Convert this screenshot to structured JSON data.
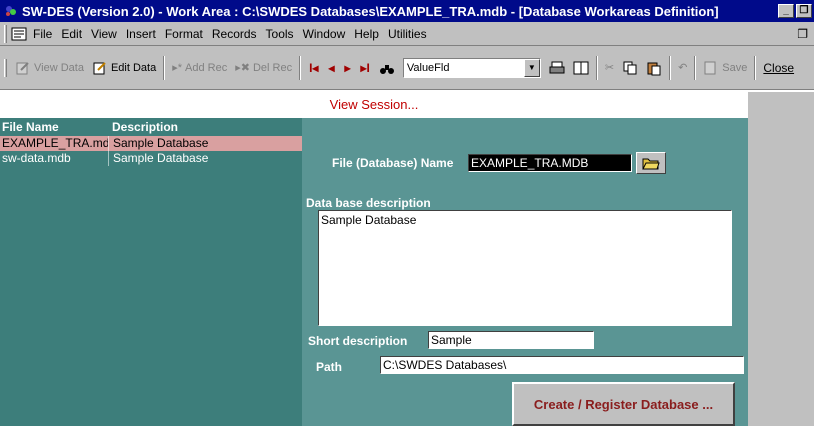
{
  "window": {
    "title": "SW-DES (Version 2.0) - Work Area : C:\\SWDES Databases\\EXAMPLE_TRA.mdb - [Database Workareas Definition]",
    "minimize": "_",
    "restore": "❐"
  },
  "menu": {
    "items": [
      "File",
      "Edit",
      "View",
      "Insert",
      "Format",
      "Records",
      "Tools",
      "Window",
      "Help",
      "Utilities"
    ],
    "doc_restore": "❐"
  },
  "toolbar": {
    "view_data": "View Data",
    "edit_data": "Edit Data",
    "add_rec": "Add Rec",
    "del_rec": "Del Rec",
    "first": "I◂",
    "prev": "◂",
    "next": "▸",
    "last": "▸I",
    "combo_value": "ValueFld",
    "combo_arrow": "▼",
    "save": "Save",
    "close": "Close"
  },
  "session": {
    "label": "View Session..."
  },
  "list": {
    "header_name": "File Name",
    "header_desc": "Description",
    "rows": [
      {
        "name": "EXAMPLE_TRA.mdb",
        "desc": "Sample Database"
      },
      {
        "name": "sw-data.mdb",
        "desc": "Sample Database"
      }
    ]
  },
  "detail": {
    "file_label": "File (Database)  Name",
    "file_value": "EXAMPLE_TRA.MDB",
    "desc_label": "Data base description",
    "desc_value": "Sample Database",
    "short_label": "Short description",
    "short_value": "Sample",
    "path_label": "Path",
    "path_value": "C:\\SWDES Databases\\",
    "create_button": "Create / Register Database ..."
  },
  "colors": {
    "titlebar": "#000a8a",
    "list_bg": "#3d7e7b",
    "detail_bg": "#5a9594",
    "selected_row": "#d9a0a0",
    "accent_red": "#c00000"
  }
}
